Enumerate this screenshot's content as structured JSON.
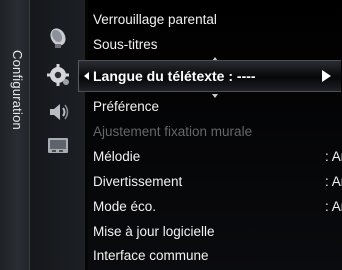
{
  "sidebar": {
    "tab_label": "Configuration"
  },
  "icons": [
    "satellite-dish-icon",
    "gear-icon",
    "speaker-icon",
    "input-card-icon"
  ],
  "menu": {
    "items": [
      {
        "label": "Verrouillage parental",
        "value": ""
      },
      {
        "label": "Sous-titres",
        "value": ""
      },
      {
        "label": "Langue du télétexte : ----",
        "value": "",
        "selected": true
      },
      {
        "label": "Préférence",
        "value": ""
      },
      {
        "label": "Ajustement fixation murale",
        "value": "",
        "disabled": true
      },
      {
        "label": "Mélodie",
        "value": ": Arrêt"
      },
      {
        "label": "Divertissement",
        "value": ": Arrêt"
      },
      {
        "label": "Mode éco.",
        "value": ": Arrêt"
      },
      {
        "label": "Mise à jour logicielle",
        "value": ""
      },
      {
        "label": "Interface commune",
        "value": ""
      }
    ]
  },
  "colors": {
    "text": "#f2f2f2",
    "disabled": "#66676b",
    "panel": "#000000",
    "highlight": "#2a2c31"
  }
}
